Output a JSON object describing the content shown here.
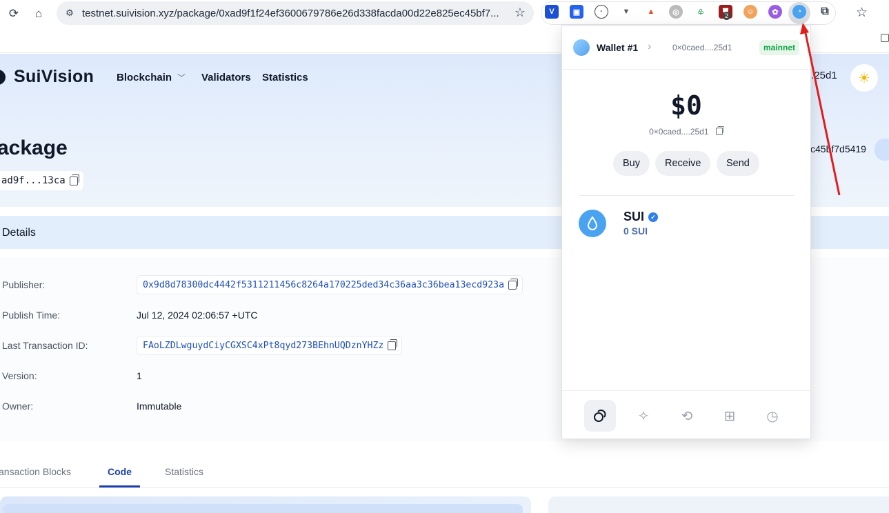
{
  "browser": {
    "url": "testnet.suivision.xyz/package/0xad9f1f24ef3600679786e26d338facda00d22e825ec45bf7...",
    "extension_badge": "2"
  },
  "site": {
    "logo": "SuiVision",
    "nav": [
      "Blockchain",
      "Validators",
      "Statistics"
    ],
    "header_address": "..25d1",
    "page_title": "ackage",
    "package_hash": "ad9f...13ca",
    "right_hash": "c45bf7d5419"
  },
  "details": {
    "title": "Details",
    "rows": [
      {
        "label": "Publisher:",
        "value": "0x9d8d78300dc4442f5311211456c8264a170225ded34c36aa3c36bea13ecd923a"
      },
      {
        "label": "Publish Time:",
        "value": "Jul 12, 2024 02:06:57 +UTC"
      },
      {
        "label": "Last Transaction ID:",
        "value": "FAoLZDLwguydCiyCGXSC4xPt8qyd273BEhnUQDznYHZz"
      },
      {
        "label": "Version:",
        "value": "1"
      },
      {
        "label": "Owner:",
        "value": "Immutable"
      }
    ]
  },
  "tabs": [
    "ansaction Blocks",
    "Code",
    "Statistics"
  ],
  "wallet": {
    "name": "Wallet #1",
    "address": "0×0caed....25d1",
    "network": "mainnet",
    "balance": "$0",
    "balance_address": "0×0caed....25d1",
    "actions": [
      "Buy",
      "Receive",
      "Send"
    ],
    "token": {
      "symbol": "SUI",
      "amount": "0 SUI"
    }
  },
  "colors": {
    "accent": "#1e40af",
    "network_green": "#16a34a",
    "arrow": "#e11d1d"
  }
}
